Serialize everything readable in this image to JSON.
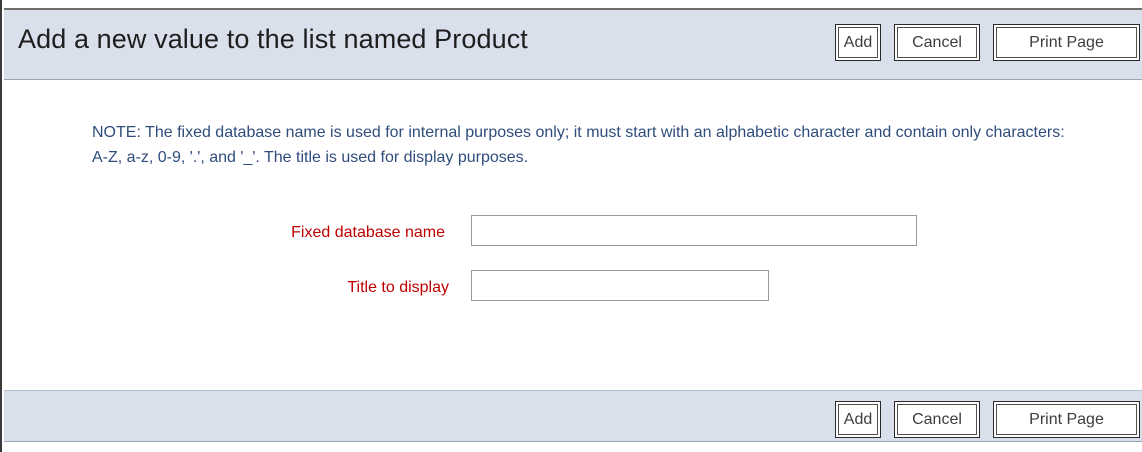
{
  "header": {
    "title": "Add a new value to the list named Product"
  },
  "toolbar": {
    "add_label": "Add",
    "cancel_label": "Cancel",
    "print_label": "Print Page"
  },
  "note": {
    "text": "NOTE: The fixed database name is used for internal purposes only; it must start with an alphabetic character and contain only characters: A-Z, a-z, 0-9, '.', and '_'. The title is used for display purposes."
  },
  "form": {
    "db_name": {
      "label": "Fixed database name",
      "value": ""
    },
    "title": {
      "label": "Title to display",
      "value": ""
    }
  },
  "colors": {
    "toolbar_background": "#d9e0ec",
    "note_text": "#2f4d7c",
    "field_label": "#c00000"
  }
}
